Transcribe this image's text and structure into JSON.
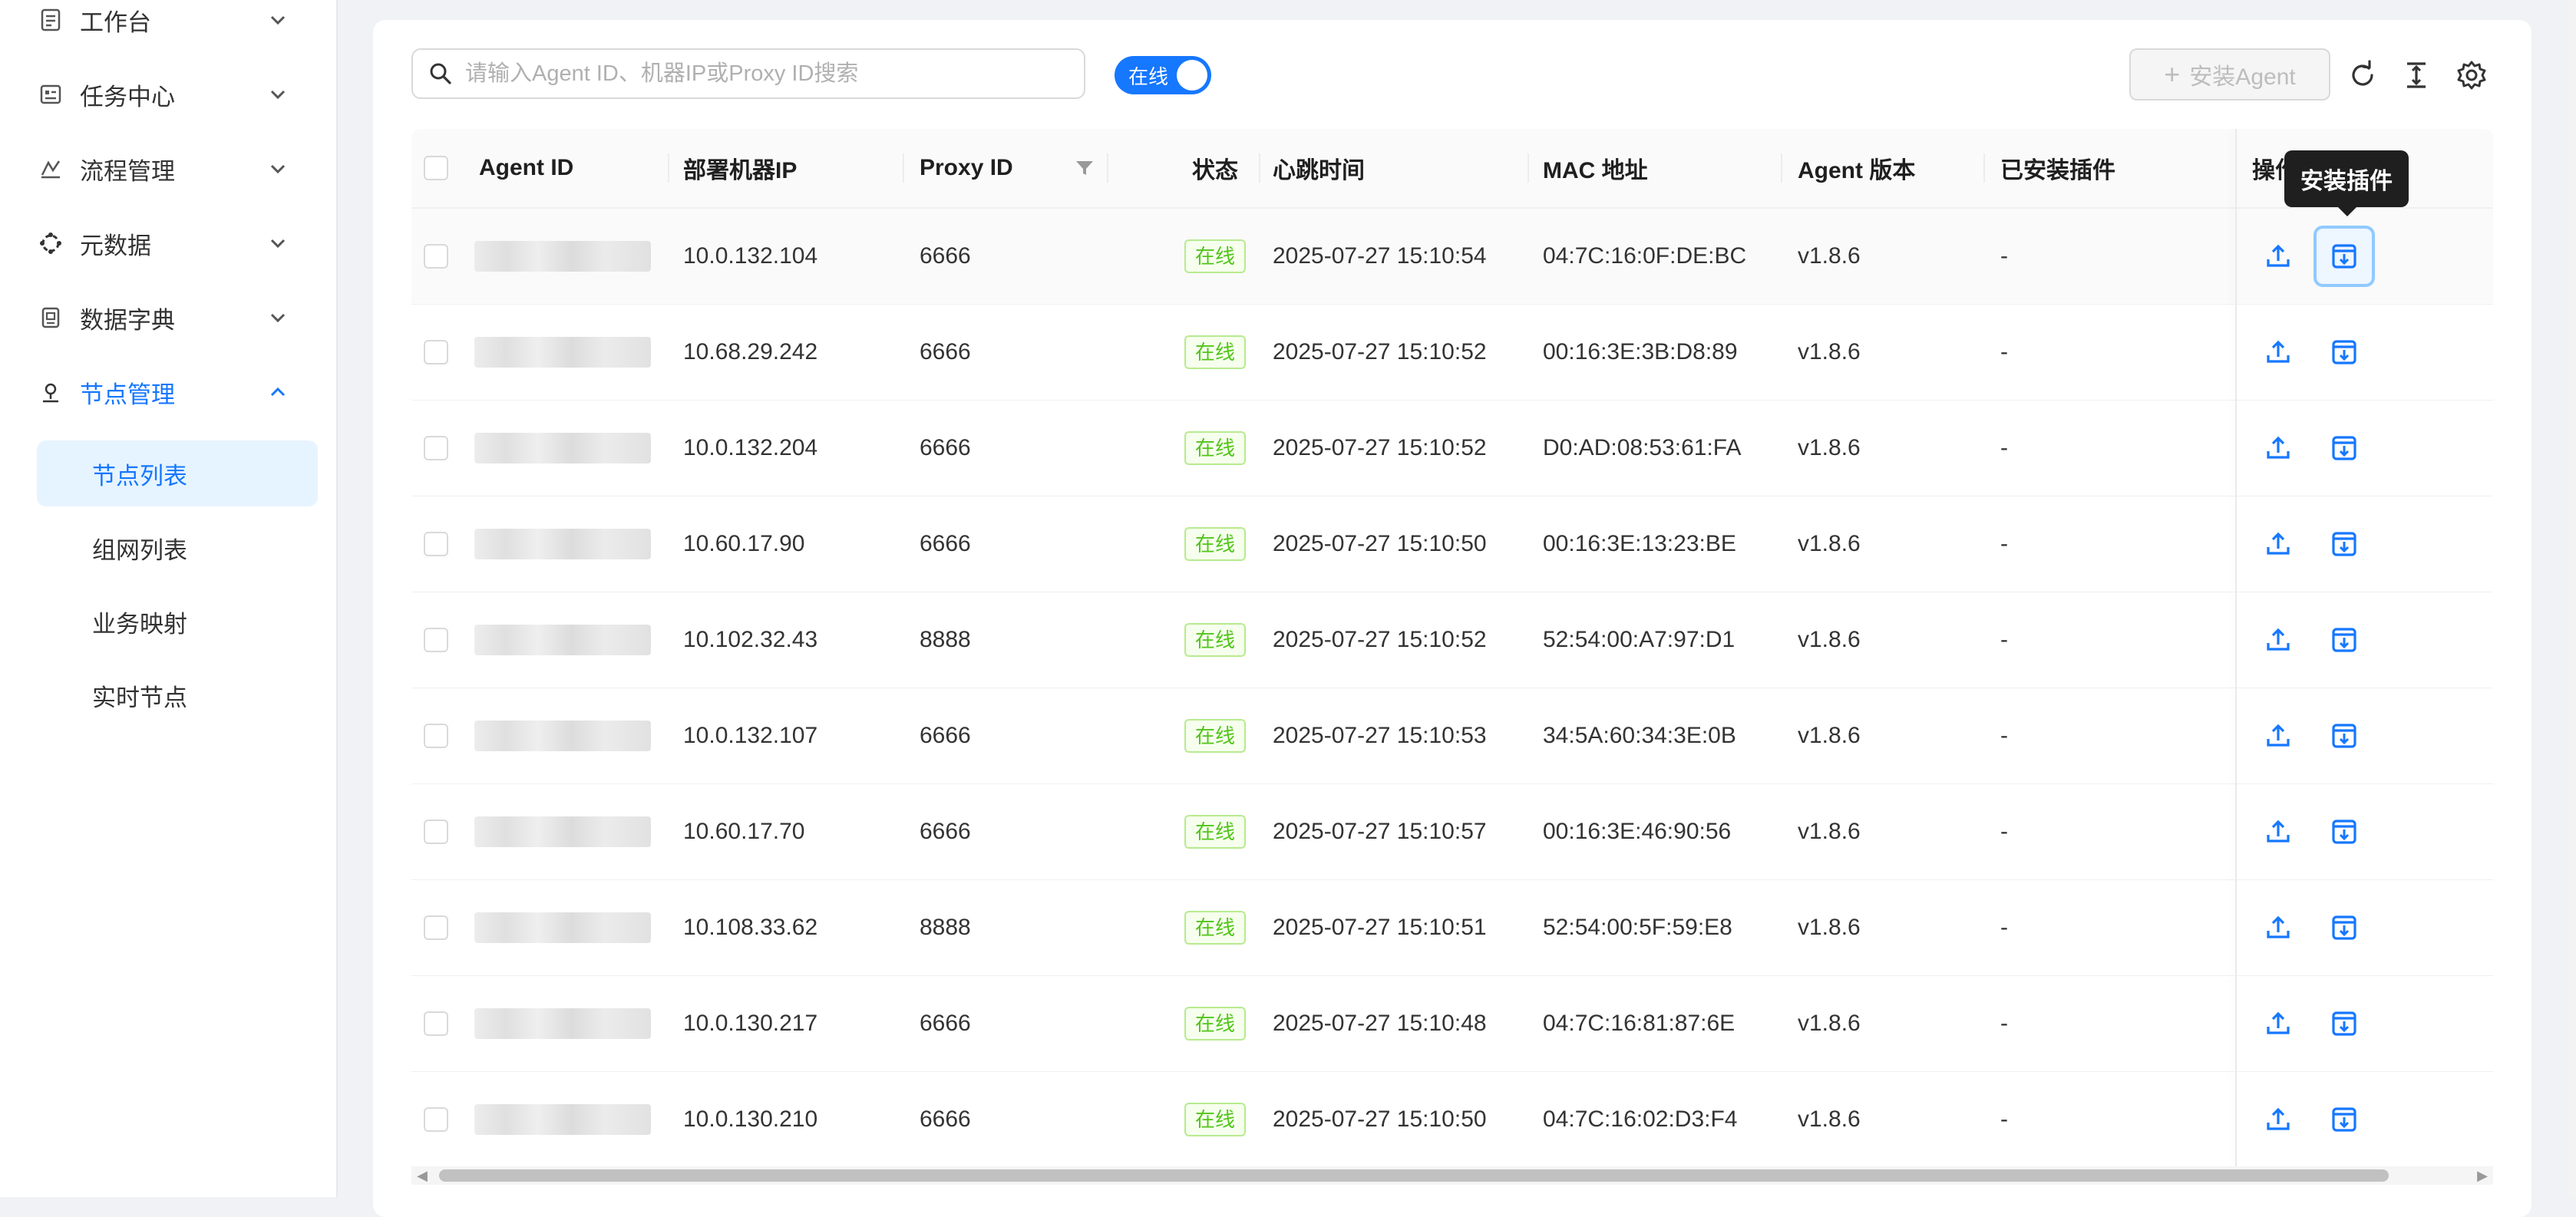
{
  "sidebar": {
    "items": [
      {
        "label": "工作台",
        "icon": "document-icon",
        "expanded": false
      },
      {
        "label": "任务中心",
        "icon": "task-icon",
        "expanded": false
      },
      {
        "label": "流程管理",
        "icon": "flow-icon",
        "expanded": false
      },
      {
        "label": "元数据",
        "icon": "metadata-icon",
        "expanded": false
      },
      {
        "label": "数据字典",
        "icon": "dictionary-icon",
        "expanded": false
      },
      {
        "label": "节点管理",
        "icon": "node-icon",
        "expanded": true,
        "active": true
      }
    ],
    "subitems": [
      {
        "label": "节点列表",
        "selected": true
      },
      {
        "label": "组网列表"
      },
      {
        "label": "业务映射"
      },
      {
        "label": "实时节点"
      }
    ]
  },
  "toolbar": {
    "search_placeholder": "请输入Agent ID、机器IP或Proxy ID搜索",
    "switch_label": "在线",
    "switch_on": true,
    "install_label": "安装Agent",
    "icons": [
      "refresh-icon",
      "column-height-icon",
      "settings-icon"
    ]
  },
  "table": {
    "columns": [
      "Agent ID",
      "部署机器IP",
      "Proxy ID",
      "状态",
      "心跳时间",
      "MAC 地址",
      "Agent 版本",
      "已安装插件",
      "操作"
    ],
    "rows": [
      {
        "ip": "10.0.132.104",
        "proxy": "6666",
        "status": "在线",
        "heartbeat": "2025-07-27 15:10:54",
        "mac": "04:7C:16:0F:DE:BC",
        "version": "v1.8.6",
        "plugins": "-"
      },
      {
        "ip": "10.68.29.242",
        "proxy": "6666",
        "status": "在线",
        "heartbeat": "2025-07-27 15:10:52",
        "mac": "00:16:3E:3B:D8:89",
        "version": "v1.8.6",
        "plugins": "-"
      },
      {
        "ip": "10.0.132.204",
        "proxy": "6666",
        "status": "在线",
        "heartbeat": "2025-07-27 15:10:52",
        "mac": "D0:AD:08:53:61:FA",
        "version": "v1.8.6",
        "plugins": "-"
      },
      {
        "ip": "10.60.17.90",
        "proxy": "6666",
        "status": "在线",
        "heartbeat": "2025-07-27 15:10:50",
        "mac": "00:16:3E:13:23:BE",
        "version": "v1.8.6",
        "plugins": "-"
      },
      {
        "ip": "10.102.32.43",
        "proxy": "8888",
        "status": "在线",
        "heartbeat": "2025-07-27 15:10:52",
        "mac": "52:54:00:A7:97:D1",
        "version": "v1.8.6",
        "plugins": "-"
      },
      {
        "ip": "10.0.132.107",
        "proxy": "6666",
        "status": "在线",
        "heartbeat": "2025-07-27 15:10:53",
        "mac": "34:5A:60:34:3E:0B",
        "version": "v1.8.6",
        "plugins": "-"
      },
      {
        "ip": "10.60.17.70",
        "proxy": "6666",
        "status": "在线",
        "heartbeat": "2025-07-27 15:10:57",
        "mac": "00:16:3E:46:90:56",
        "version": "v1.8.6",
        "plugins": "-"
      },
      {
        "ip": "10.108.33.62",
        "proxy": "8888",
        "status": "在线",
        "heartbeat": "2025-07-27 15:10:51",
        "mac": "52:54:00:5F:59:E8",
        "version": "v1.8.6",
        "plugins": "-"
      },
      {
        "ip": "10.0.130.217",
        "proxy": "6666",
        "status": "在线",
        "heartbeat": "2025-07-27 15:10:48",
        "mac": "04:7C:16:81:87:6E",
        "version": "v1.8.6",
        "plugins": "-"
      },
      {
        "ip": "10.0.130.210",
        "proxy": "6666",
        "status": "在线",
        "heartbeat": "2025-07-27 15:10:50",
        "mac": "04:7C:16:02:D3:F4",
        "version": "v1.8.6",
        "plugins": "-"
      }
    ],
    "row_actions": [
      "upload-icon",
      "install-plugin-icon"
    ]
  },
  "tooltip": {
    "text": "安装插件"
  },
  "colors": {
    "accent": "#1677ff",
    "online_tag_text": "#52c41a",
    "online_tag_bg": "#f6ffed",
    "online_tag_border": "#b7eb8f"
  }
}
